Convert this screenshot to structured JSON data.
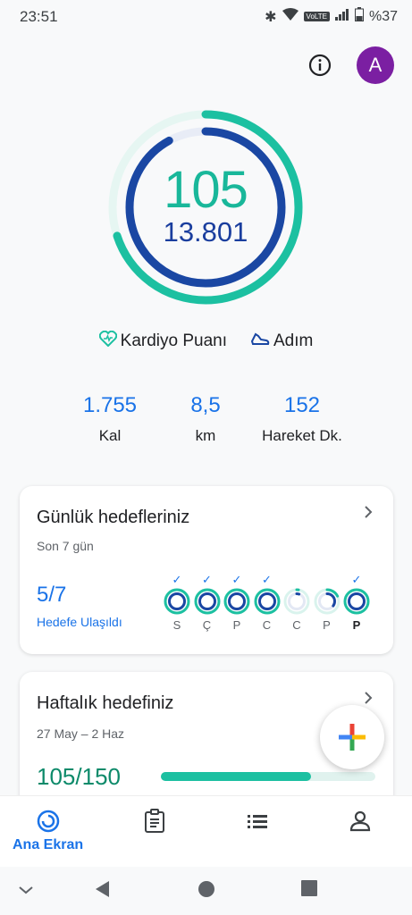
{
  "status": {
    "time": "23:51",
    "battery": "%37",
    "network": "VoLTE"
  },
  "header": {
    "info_icon": "info-icon",
    "avatar_letter": "A",
    "avatar_color": "#7b1fa2"
  },
  "rings": {
    "heart_points": "105",
    "steps": "13.801",
    "heart_color": "#1cc0a1",
    "steps_color": "#1a47a3",
    "heart_progress": 0.7,
    "steps_progress": 0.92
  },
  "legend": {
    "heart": "Kardiyo Puanı",
    "steps": "Adım"
  },
  "stats": [
    {
      "value": "1.755",
      "label": "Kal"
    },
    {
      "value": "8,5",
      "label": "km"
    },
    {
      "value": "152",
      "label": "Hareket Dk."
    }
  ],
  "daily": {
    "title": "Günlük hedefleriniz",
    "subtitle": "Son 7 gün",
    "count": "5/7",
    "count_label": "Hedefe Ulaşıldı",
    "days": [
      {
        "letter": "S",
        "met": true,
        "progress": 1.0
      },
      {
        "letter": "Ç",
        "met": true,
        "progress": 1.0
      },
      {
        "letter": "P",
        "met": true,
        "progress": 1.0
      },
      {
        "letter": "C",
        "met": true,
        "progress": 1.0
      },
      {
        "letter": "C",
        "met": false,
        "progress": 0.05
      },
      {
        "letter": "P",
        "met": false,
        "progress": 0.35
      },
      {
        "letter": "P",
        "met": true,
        "progress": 1.0
      }
    ]
  },
  "weekly": {
    "title": "Haftalık hedefiniz",
    "subtitle": "27 May – 2 Haz",
    "value": "105/150",
    "progress": 0.7
  },
  "nav": {
    "home": "Ana Ekran"
  }
}
